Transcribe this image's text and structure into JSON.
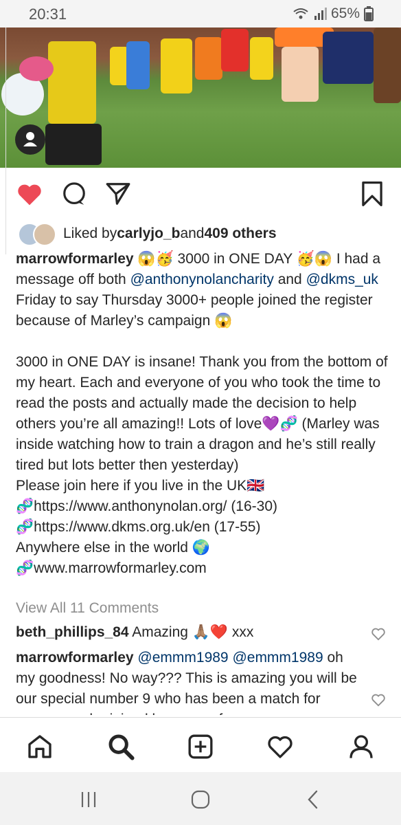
{
  "status_bar": {
    "time": "20:31",
    "battery": "65%"
  },
  "post": {
    "liked_by_prefix": "Liked by ",
    "liked_by_user": "carlyjo_b",
    "liked_by_and": " and ",
    "liked_by_others": "409 others",
    "caption_user": "marrowformarley",
    "caption_part1": " 😱🥳 3000 in ONE DAY 🥳😱 I had a message off both ",
    "mention1": "@anthonynolancharity",
    "caption_part2": " and ",
    "mention2": "@dkms_uk",
    "caption_part3": " Friday to say Thursday 3000+ people joined the register because of Marley’s campaign 😱\n\n3000 in ONE DAY is insane! Thank you from the bottom of my heart. Each and everyone of you who took the time to read the posts and actually made the decision to help others you’re all amazing!! Lots of love💜🧬 (Marley was inside watching how to train a dragon and he’s still really tired but lots better then yesterday)\nPlease join here if you live in the UK🇬🇧\n🧬https://www.anthonynolan.org/ (16-30)\n🧬https://www.dkms.org.uk/en (17-55)\nAnywhere else in the world 🌍\n🧬www.marrowformarley.com",
    "view_all_comments": "View All 11 Comments"
  },
  "comments": [
    {
      "user": "beth_phillips_84",
      "text": " Amazing 🙏🏽❤️ xxx"
    },
    {
      "user": "marrowformarley",
      "mention": " @emmm1989 @emmm1989",
      "text": " oh my goodness! No way??? This is amazing you will be our special number 9 who has been a match for someone who joined because of"
    }
  ],
  "icons": {
    "like": "heart-icon",
    "comment": "comment-icon",
    "share": "send-icon",
    "save": "bookmark-icon",
    "nav": [
      "home-icon",
      "search-icon",
      "add-post-icon",
      "activity-heart-icon",
      "profile-icon"
    ],
    "system": [
      "recent-apps-icon",
      "home-button-icon",
      "back-icon"
    ]
  },
  "colors": {
    "like_red": "#ed4956",
    "mention_blue": "#003569",
    "muted": "#8e8e8e"
  }
}
